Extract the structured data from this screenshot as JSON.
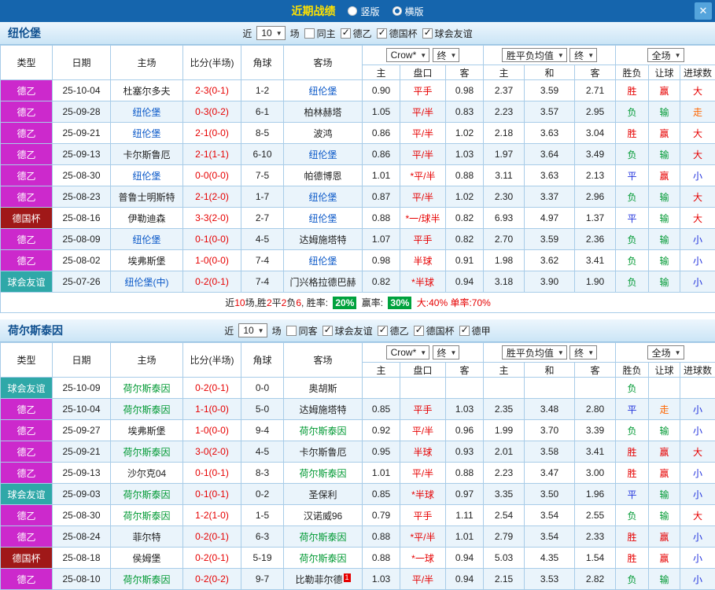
{
  "topbar": {
    "title": "近期战绩",
    "vertical": "竖版",
    "horizontal": "横版",
    "selected": "横版",
    "close": "✕"
  },
  "labels": {
    "near": "近",
    "games": "场"
  },
  "table_header": {
    "type": "类型",
    "date": "日期",
    "home": "主场",
    "score": "比分(半场)",
    "corner": "角球",
    "away": "客场",
    "odds_source": "Crow*",
    "odds_period": "终",
    "odds_cols": [
      "主",
      "盘口",
      "客"
    ],
    "avg_label": "胜平负均值",
    "avg_period": "终",
    "avg_cols": [
      "主",
      "和",
      "客"
    ],
    "scope": "全场",
    "result_cols": [
      "胜负",
      "让球",
      "进球数"
    ]
  },
  "colors": {
    "topbar-bg": "#1565AD",
    "title": "#FFE100",
    "close-bg": "#54A4DC",
    "teambar-from": "#EDF6FD",
    "teambar-to": "#CBE5F6",
    "team-title": "#0D4E8E",
    "grid-border": "#A8CCE8",
    "row-alt": "#EAF4FB",
    "type-de2": "#CC29CC",
    "type-cup": "#A01818",
    "type-fri": "#2FA8A8",
    "team-a": "#0A58C8",
    "team-b": "#009933",
    "red": "#E60000",
    "green": "#009933",
    "blue": "#2233DD",
    "orange": "#FF6600",
    "badge-bg": "#00A23D"
  },
  "sections": [
    {
      "team": "纽伦堡",
      "filter": {
        "count": "10",
        "checkboxes": [
          {
            "label": "同主",
            "checked": false
          },
          {
            "label": "德乙",
            "checked": true
          },
          {
            "label": "德国杯",
            "checked": true
          },
          {
            "label": "球会友谊",
            "checked": true
          }
        ]
      },
      "rows": [
        {
          "t": "德乙",
          "tc": "de2",
          "d": "25-10-04",
          "h": "杜塞尔多夫",
          "hf": false,
          "s": "2-3(0-1)",
          "c": "1-2",
          "a": "纽伦堡",
          "af": true,
          "o1": "0.90",
          "hc": "平手",
          "o2": "0.98",
          "m1": "2.37",
          "m2": "3.59",
          "m3": "2.71",
          "r1": "胜",
          "c1": "red",
          "r2": "赢",
          "c2": "red",
          "r3": "大",
          "c3": "red"
        },
        {
          "t": "德乙",
          "tc": "de2",
          "d": "25-09-28",
          "h": "纽伦堡",
          "hf": true,
          "s": "0-3(0-2)",
          "c": "6-1",
          "a": "柏林赫塔",
          "af": false,
          "o1": "1.05",
          "hc": "平/半",
          "o2": "0.83",
          "m1": "2.23",
          "m2": "3.57",
          "m3": "2.95",
          "r1": "负",
          "c1": "green",
          "r2": "输",
          "c2": "green",
          "r3": "走",
          "c3": "orange"
        },
        {
          "t": "德乙",
          "tc": "de2",
          "d": "25-09-21",
          "h": "纽伦堡",
          "hf": true,
          "s": "2-1(0-0)",
          "c": "8-5",
          "a": "波鸿",
          "af": false,
          "o1": "0.86",
          "hc": "平/半",
          "o2": "1.02",
          "m1": "2.18",
          "m2": "3.63",
          "m3": "3.04",
          "r1": "胜",
          "c1": "red",
          "r2": "赢",
          "c2": "red",
          "r3": "大",
          "c3": "red"
        },
        {
          "t": "德乙",
          "tc": "de2",
          "d": "25-09-13",
          "h": "卡尔斯鲁厄",
          "hf": false,
          "s": "2-1(1-1)",
          "c": "6-10",
          "a": "纽伦堡",
          "af": true,
          "o1": "0.86",
          "hc": "平/半",
          "o2": "1.03",
          "m1": "1.97",
          "m2": "3.64",
          "m3": "3.49",
          "r1": "负",
          "c1": "green",
          "r2": "输",
          "c2": "green",
          "r3": "大",
          "c3": "red"
        },
        {
          "t": "德乙",
          "tc": "de2",
          "d": "25-08-30",
          "h": "纽伦堡",
          "hf": true,
          "s": "0-0(0-0)",
          "c": "7-5",
          "a": "帕德博恩",
          "af": false,
          "o1": "1.01",
          "hc": "*平/半",
          "o2": "0.88",
          "m1": "3.11",
          "m2": "3.63",
          "m3": "2.13",
          "r1": "平",
          "c1": "blue",
          "r2": "赢",
          "c2": "red",
          "r3": "小",
          "c3": "blue"
        },
        {
          "t": "德乙",
          "tc": "de2",
          "d": "25-08-23",
          "h": "普鲁士明斯特",
          "hf": false,
          "s": "2-1(2-0)",
          "c": "1-7",
          "a": "纽伦堡",
          "af": true,
          "o1": "0.87",
          "hc": "平/半",
          "o2": "1.02",
          "m1": "2.30",
          "m2": "3.37",
          "m3": "2.96",
          "r1": "负",
          "c1": "green",
          "r2": "输",
          "c2": "green",
          "r3": "大",
          "c3": "red"
        },
        {
          "t": "德国杯",
          "tc": "cup",
          "d": "25-08-16",
          "h": "伊勒迪森",
          "hf": false,
          "s": "3-3(2-0)",
          "c": "2-7",
          "a": "纽伦堡",
          "af": true,
          "o1": "0.88",
          "hc": "*一/球半",
          "o2": "0.82",
          "m1": "6.93",
          "m2": "4.97",
          "m3": "1.37",
          "r1": "平",
          "c1": "blue",
          "r2": "输",
          "c2": "green",
          "r3": "大",
          "c3": "red"
        },
        {
          "t": "德乙",
          "tc": "de2",
          "d": "25-08-09",
          "h": "纽伦堡",
          "hf": true,
          "s": "0-1(0-0)",
          "c": "4-5",
          "a": "达姆施塔特",
          "af": false,
          "o1": "1.07",
          "hc": "平手",
          "o2": "0.82",
          "m1": "2.70",
          "m2": "3.59",
          "m3": "2.36",
          "r1": "负",
          "c1": "green",
          "r2": "输",
          "c2": "green",
          "r3": "小",
          "c3": "blue"
        },
        {
          "t": "德乙",
          "tc": "de2",
          "d": "25-08-02",
          "h": "埃弗斯堡",
          "hf": false,
          "s": "1-0(0-0)",
          "c": "7-4",
          "a": "纽伦堡",
          "af": true,
          "o1": "0.98",
          "hc": "半球",
          "o2": "0.91",
          "m1": "1.98",
          "m2": "3.62",
          "m3": "3.41",
          "r1": "负",
          "c1": "green",
          "r2": "输",
          "c2": "green",
          "r3": "小",
          "c3": "blue"
        },
        {
          "t": "球会友谊",
          "tc": "fri",
          "d": "25-07-26",
          "h": "纽伦堡(中)",
          "hf": true,
          "s": "0-2(0-1)",
          "c": "7-4",
          "a": "门兴格拉德巴赫",
          "af": false,
          "o1": "0.82",
          "hc": "*半球",
          "o2": "0.94",
          "m1": "3.18",
          "m2": "3.90",
          "m3": "1.90",
          "r1": "负",
          "c1": "green",
          "r2": "输",
          "c2": "green",
          "r3": "小",
          "c3": "blue"
        }
      ],
      "summary": {
        "parts": [
          {
            "text": "近",
            "style": "black"
          },
          {
            "text": "10",
            "style": "red"
          },
          {
            "text": "场,胜",
            "style": "black"
          },
          {
            "text": "2",
            "style": "red"
          },
          {
            "text": "平",
            "style": "black"
          },
          {
            "text": "2",
            "style": "red"
          },
          {
            "text": "负",
            "style": "black"
          },
          {
            "text": "6",
            "style": "red"
          },
          {
            "text": ", 胜率: ",
            "style": "black"
          },
          {
            "text": "20%",
            "style": "badge"
          },
          {
            "text": " 赢率: ",
            "style": "black"
          },
          {
            "text": "30%",
            "style": "badge"
          },
          {
            "text": " 大:40%",
            "style": "red"
          },
          {
            "text": " 单率:70%",
            "style": "red"
          }
        ]
      }
    },
    {
      "team": "荷尔斯泰因",
      "filter": {
        "count": "10",
        "checkboxes": [
          {
            "label": "同客",
            "checked": false
          },
          {
            "label": "球会友谊",
            "checked": true
          },
          {
            "label": "德乙",
            "checked": true
          },
          {
            "label": "德国杯",
            "checked": true
          },
          {
            "label": "德甲",
            "checked": true
          }
        ]
      },
      "rows": [
        {
          "t": "球会友谊",
          "tc": "fri",
          "d": "25-10-09",
          "h": "荷尔斯泰因",
          "hf": true,
          "s": "0-2(0-1)",
          "c": "0-0",
          "a": "奥胡斯",
          "af": false,
          "o1": "",
          "hc": "",
          "o2": "",
          "m1": "",
          "m2": "",
          "m3": "",
          "r1": "负",
          "c1": "green",
          "r2": "",
          "c2": "",
          "r3": "",
          "c3": ""
        },
        {
          "t": "德乙",
          "tc": "de2",
          "d": "25-10-04",
          "h": "荷尔斯泰因",
          "hf": true,
          "s": "1-1(0-0)",
          "c": "5-0",
          "a": "达姆施塔特",
          "af": false,
          "o1": "0.85",
          "hc": "平手",
          "o2": "1.03",
          "m1": "2.35",
          "m2": "3.48",
          "m3": "2.80",
          "r1": "平",
          "c1": "blue",
          "r2": "走",
          "c2": "orange",
          "r3": "小",
          "c3": "blue"
        },
        {
          "t": "德乙",
          "tc": "de2",
          "d": "25-09-27",
          "h": "埃弗斯堡",
          "hf": false,
          "s": "1-0(0-0)",
          "c": "9-4",
          "a": "荷尔斯泰因",
          "af": true,
          "o1": "0.92",
          "hc": "平/半",
          "o2": "0.96",
          "m1": "1.99",
          "m2": "3.70",
          "m3": "3.39",
          "r1": "负",
          "c1": "green",
          "r2": "输",
          "c2": "green",
          "r3": "小",
          "c3": "blue"
        },
        {
          "t": "德乙",
          "tc": "de2",
          "d": "25-09-21",
          "h": "荷尔斯泰因",
          "hf": true,
          "s": "3-0(2-0)",
          "c": "4-5",
          "a": "卡尔斯鲁厄",
          "af": false,
          "o1": "0.95",
          "hc": "半球",
          "o2": "0.93",
          "m1": "2.01",
          "m2": "3.58",
          "m3": "3.41",
          "r1": "胜",
          "c1": "red",
          "r2": "赢",
          "c2": "red",
          "r3": "大",
          "c3": "red"
        },
        {
          "t": "德乙",
          "tc": "de2",
          "d": "25-09-13",
          "h": "沙尔克04",
          "hf": false,
          "s": "0-1(0-1)",
          "c": "8-3",
          "a": "荷尔斯泰因",
          "af": true,
          "o1": "1.01",
          "hc": "平/半",
          "o2": "0.88",
          "m1": "2.23",
          "m2": "3.47",
          "m3": "3.00",
          "r1": "胜",
          "c1": "red",
          "r2": "赢",
          "c2": "red",
          "r3": "小",
          "c3": "blue"
        },
        {
          "t": "球会友谊",
          "tc": "fri",
          "d": "25-09-03",
          "h": "荷尔斯泰因",
          "hf": true,
          "s": "0-1(0-1)",
          "c": "0-2",
          "a": "圣保利",
          "af": false,
          "o1": "0.85",
          "hc": "*半球",
          "o2": "0.97",
          "m1": "3.35",
          "m2": "3.50",
          "m3": "1.96",
          "r1": "平",
          "c1": "blue",
          "r2": "输",
          "c2": "green",
          "r3": "小",
          "c3": "blue"
        },
        {
          "t": "德乙",
          "tc": "de2",
          "d": "25-08-30",
          "h": "荷尔斯泰因",
          "hf": true,
          "s": "1-2(1-0)",
          "c": "1-5",
          "a": "汉诺威96",
          "af": false,
          "o1": "0.79",
          "hc": "平手",
          "o2": "1.11",
          "m1": "2.54",
          "m2": "3.54",
          "m3": "2.55",
          "r1": "负",
          "c1": "green",
          "r2": "输",
          "c2": "green",
          "r3": "大",
          "c3": "red"
        },
        {
          "t": "德乙",
          "tc": "de2",
          "d": "25-08-24",
          "h": "菲尔特",
          "hf": false,
          "s": "0-2(0-1)",
          "c": "6-3",
          "a": "荷尔斯泰因",
          "af": true,
          "o1": "0.88",
          "hc": "*平/半",
          "o2": "1.01",
          "m1": "2.79",
          "m2": "3.54",
          "m3": "2.33",
          "r1": "胜",
          "c1": "red",
          "r2": "赢",
          "c2": "red",
          "r3": "小",
          "c3": "blue"
        },
        {
          "t": "德国杯",
          "tc": "cup",
          "d": "25-08-18",
          "h": "侯姆堡",
          "hf": false,
          "s": "0-2(0-1)",
          "c": "5-19",
          "a": "荷尔斯泰因",
          "af": true,
          "o1": "0.88",
          "hc": "*一球",
          "o2": "0.94",
          "m1": "5.03",
          "m2": "4.35",
          "m3": "1.54",
          "r1": "胜",
          "c1": "red",
          "r2": "赢",
          "c2": "red",
          "r3": "小",
          "c3": "blue"
        },
        {
          "t": "德乙",
          "tc": "de2",
          "d": "25-08-10",
          "h": "荷尔斯泰因",
          "hf": true,
          "s": "0-2(0-2)",
          "c": "9-7",
          "a": "比勒菲尔德",
          "asup": "1",
          "af": false,
          "o1": "1.03",
          "hc": "平/半",
          "o2": "0.94",
          "m1": "2.15",
          "m2": "3.53",
          "m3": "2.82",
          "r1": "负",
          "c1": "green",
          "r2": "输",
          "c2": "green",
          "r3": "小",
          "c3": "blue"
        }
      ],
      "summary": null
    }
  ]
}
